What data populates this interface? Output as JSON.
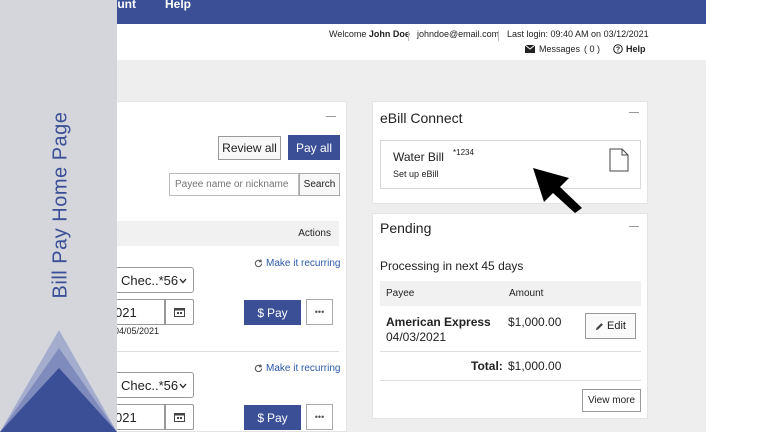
{
  "topnav": {
    "item_account": "ount",
    "item_help": "Help"
  },
  "userbar": {
    "welcome_prefix": "Welcome",
    "user_name": "John Doe",
    "email": "johndoe@email.com",
    "last_login": "Last login: 09:40 AM on 03/12/2021",
    "messages_label": "Messages",
    "messages_count": "( 0 )",
    "help_label": "Help"
  },
  "sidebar": {
    "title": "Bill Pay Home Page"
  },
  "payments": {
    "review_all": "Review all",
    "pay_all": "Pay all",
    "search_placeholder": "Payee name or nickname",
    "search_button": "Search",
    "actions_header": "Actions",
    "rows": [
      {
        "account": "Chec..*56",
        "date": "021",
        "due_date": "04/05/2021",
        "recurring": "Make it recurring",
        "pay": "Pay",
        "currency_symbol": "$",
        "more": "•••"
      },
      {
        "account": "Chec..*56",
        "date": "021",
        "due_date": "",
        "recurring": "Make it recurring",
        "pay": "Pay",
        "currency_symbol": "$",
        "more": "•••"
      }
    ]
  },
  "ebill": {
    "title": "eBill Connect",
    "card_name": "Water Bill",
    "card_account": "*1234",
    "card_action": "Set up eBill"
  },
  "pending": {
    "title": "Pending",
    "subtitle": "Processing in next 45 days",
    "col_payee": "Payee",
    "col_amount": "Amount",
    "item_payee": "American Express",
    "item_date": "04/03/2021",
    "item_amount": "$1,000.00",
    "edit_button": "Edit",
    "total_label": "Total:",
    "total_amount": "$1,000.00",
    "view_more": "View more"
  },
  "colors": {
    "brand": "#3a4f96",
    "sidebar_bg": "#d4d6dc",
    "link": "#2a5aa8"
  }
}
